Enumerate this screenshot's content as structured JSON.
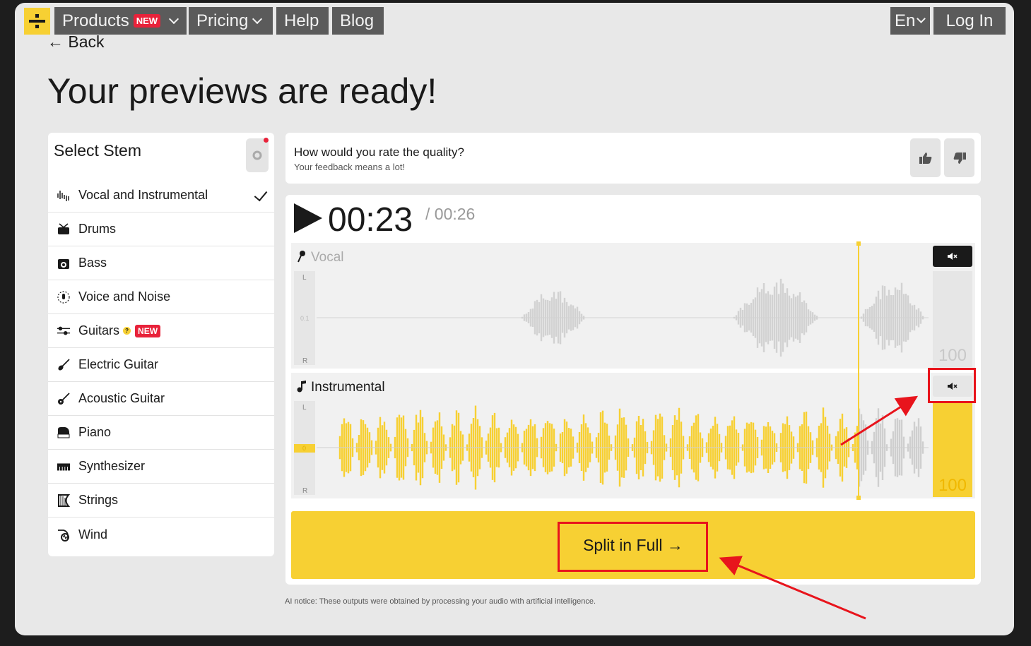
{
  "nav": {
    "products": "Products",
    "products_badge": "NEW",
    "pricing": "Pricing",
    "help": "Help",
    "blog": "Blog",
    "language": "En",
    "login": "Log In"
  },
  "back_label": "← Back",
  "page_title": "Your previews are ready!",
  "stems": {
    "header": "Select Stem",
    "items": [
      {
        "label": "Vocal and Instrumental",
        "icon": "waveform-icon",
        "selected": true
      },
      {
        "label": "Drums",
        "icon": "drum-icon"
      },
      {
        "label": "Bass",
        "icon": "amp-icon"
      },
      {
        "label": "Voice and Noise",
        "icon": "voice-noise-icon"
      },
      {
        "label": "Guitars",
        "icon": "guitars-icon",
        "help": "?",
        "badge": "NEW"
      },
      {
        "label": "Electric Guitar",
        "icon": "electric-guitar-icon"
      },
      {
        "label": "Acoustic Guitar",
        "icon": "acoustic-guitar-icon"
      },
      {
        "label": "Piano",
        "icon": "piano-icon"
      },
      {
        "label": "Synthesizer",
        "icon": "synth-icon"
      },
      {
        "label": "Strings",
        "icon": "harp-icon"
      },
      {
        "label": "Wind",
        "icon": "horn-icon"
      }
    ]
  },
  "feedback": {
    "question": "How would you rate the quality?",
    "subtitle": "Your feedback means a lot!"
  },
  "player": {
    "current_time": "00:23",
    "total_time": "/ 00:26",
    "progress": 0.885,
    "tracks": [
      {
        "name": "Vocal",
        "meter_top": "L",
        "meter_mid": "0.1",
        "meter_bottom": "R",
        "volume": "100",
        "muted": true
      },
      {
        "name": "Instrumental",
        "meter_top": "L",
        "meter_mid": "0",
        "meter_bottom": "R",
        "volume": "100",
        "muted": false
      }
    ]
  },
  "split_label": "Split in Full →",
  "ai_notice": "AI notice: These outputs were obtained by processing your audio with artificial intelligence.",
  "colors": {
    "accent": "#f7d033",
    "badge": "#e8223a",
    "nav": "#5b5b5b",
    "annotation": "#e8141c"
  }
}
